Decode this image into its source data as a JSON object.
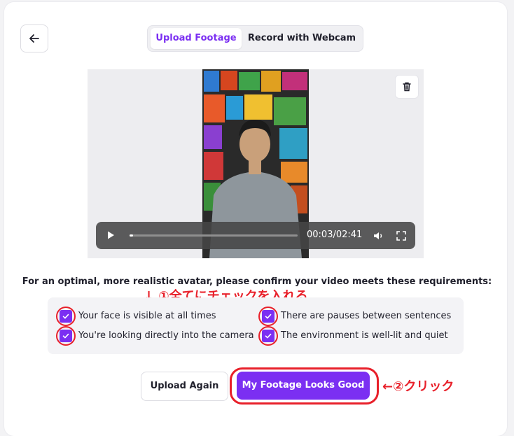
{
  "tabs": {
    "upload_label": "Upload Footage",
    "webcam_label": "Record with Webcam"
  },
  "player": {
    "time_display": "00:03/02:41",
    "progress": 0.02
  },
  "requirements": {
    "title": "For an optimal, more realistic avatar, please confirm your video meets these requirements:",
    "items": [
      {
        "label": "Your face is visible at all times",
        "checked": true
      },
      {
        "label": "There are pauses between sentences",
        "checked": true
      },
      {
        "label": "You're looking directly into the camera",
        "checked": true
      },
      {
        "label": "The environment is well-lit and quiet",
        "checked": true
      }
    ]
  },
  "actions": {
    "upload_again_label": "Upload Again",
    "looks_good_label": "My Footage Looks Good"
  },
  "annotations": {
    "step1": "↓ ①全てにチェックを入れる",
    "step2": "←②クリック"
  },
  "colors": {
    "accent": "#7b2ff2",
    "annotation": "#e8202a"
  },
  "icons": [
    "arrow-left-icon",
    "trash-icon",
    "play-icon",
    "volume-icon",
    "fullscreen-icon",
    "checkmark-icon"
  ]
}
